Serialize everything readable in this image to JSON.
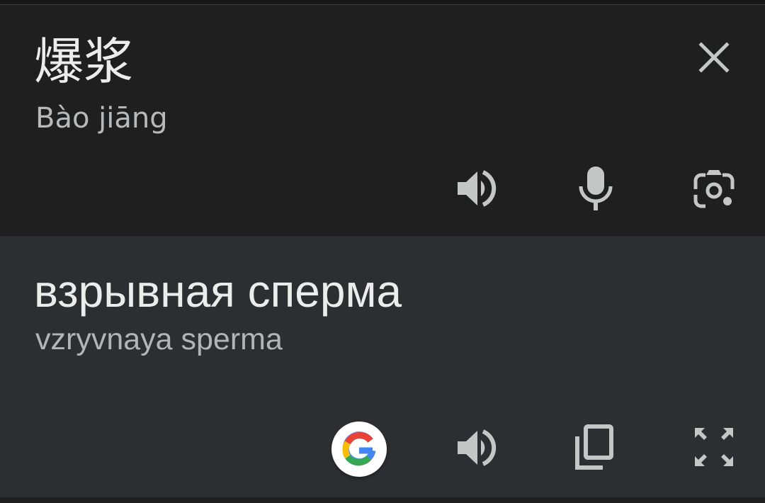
{
  "source": {
    "text": "爆浆",
    "transliteration": "Bào jiāng",
    "actions": [
      "close-icon",
      "speaker-icon",
      "microphone-icon",
      "camera-icon"
    ]
  },
  "target": {
    "text": "взрывная сперма",
    "transliteration": "vzryvnaya sperma",
    "actions": [
      "google-search-icon",
      "speaker-icon",
      "copy-icon",
      "fullscreen-icon"
    ]
  },
  "colors": {
    "source_panel_bg": "#1f1f1f",
    "target_panel_bg": "#2d2e31",
    "primary_text": "#ececec",
    "secondary_text": "#b8b9bb",
    "icon_color": "#c4c7c5"
  }
}
